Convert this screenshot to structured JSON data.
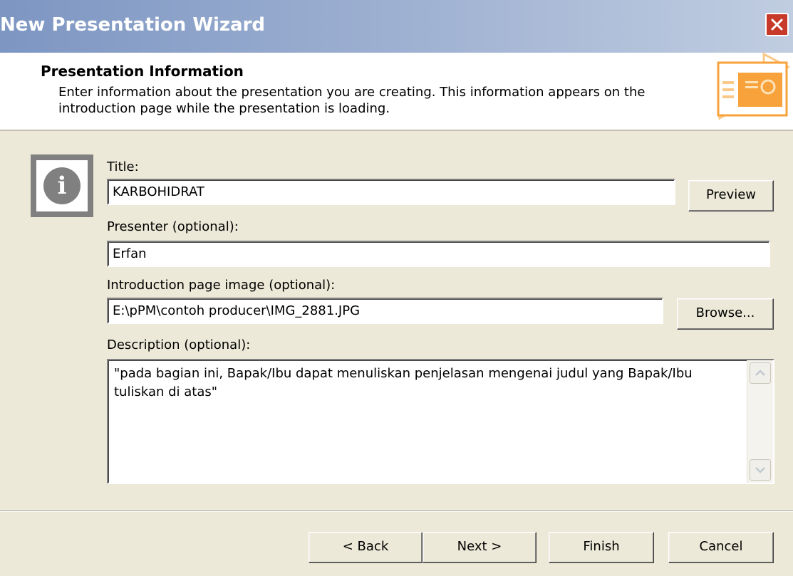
{
  "window": {
    "title": "New Presentation Wizard",
    "close_glyph": "✕"
  },
  "header": {
    "title": "Presentation Information",
    "description": "Enter information about the presentation you are creating. This information appears on the introduction page while the presentation is loading.",
    "icon": "presentation-wizard-icon"
  },
  "info_icon": {
    "glyph": "i",
    "icon": "info-icon"
  },
  "form": {
    "title_label": "Title:",
    "title_value": "KARBOHIDRAT",
    "preview_label": "Preview",
    "presenter_label": "Presenter (optional):",
    "presenter_value": "Erfan",
    "image_label": "Introduction page image (optional):",
    "image_value": "E:\\pPM\\contoh producer\\IMG_2881.JPG",
    "browse_label": "Browse...",
    "description_label": "Description (optional):",
    "description_value": "\"pada bagian ini, Bapak/Ibu dapat menuliskan penjelasan mengenai judul yang Bapak/Ibu tuliskan di atas\""
  },
  "footer": {
    "back_label": "< Back",
    "next_label": "Next >",
    "finish_label": "Finish",
    "cancel_label": "Cancel"
  },
  "colors": {
    "titlebar_start": "#7d96c2",
    "titlebar_end": "#c0cde1",
    "dialog_bg": "#ece9d8",
    "close_button": "#c73a2a",
    "accent_orange": "#f7a23a"
  }
}
